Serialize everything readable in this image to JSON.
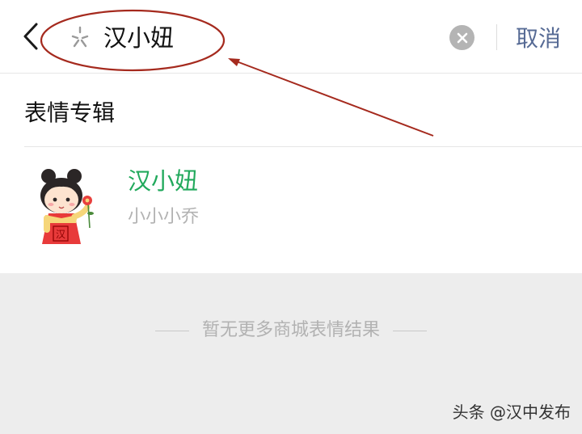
{
  "search": {
    "query": "汉小妞",
    "cancel_label": "取消"
  },
  "section": {
    "title": "表情专辑"
  },
  "results": [
    {
      "title": "汉小妞",
      "author": "小小小乔",
      "sticker_stamp_text": "汉"
    }
  ],
  "footer": {
    "no_more_text": "暂无更多商城表情结果"
  },
  "watermark": {
    "text": "头条 @汉中发布"
  },
  "colors": {
    "accent_green": "#21a95c",
    "link_blue": "#576b95",
    "annotation_red": "#a52a1e",
    "page_gray": "#ededed"
  },
  "icons": [
    "back-arrow-icon",
    "search-icon",
    "clear-icon"
  ]
}
